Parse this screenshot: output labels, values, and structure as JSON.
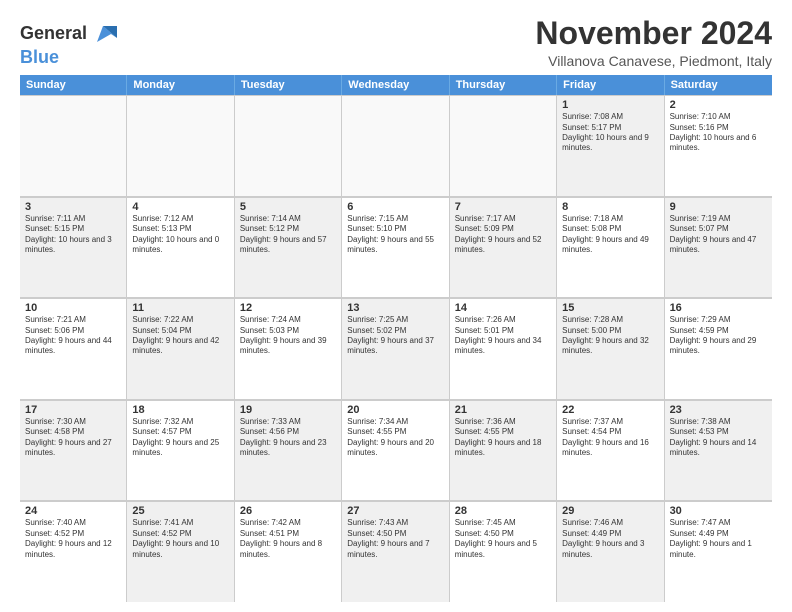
{
  "logo": {
    "line1": "General",
    "line2": "Blue"
  },
  "title": "November 2024",
  "subtitle": "Villanova Canavese, Piedmont, Italy",
  "days": [
    "Sunday",
    "Monday",
    "Tuesday",
    "Wednesday",
    "Thursday",
    "Friday",
    "Saturday"
  ],
  "rows": [
    [
      {
        "day": "",
        "text": "",
        "empty": true
      },
      {
        "day": "",
        "text": "",
        "empty": true
      },
      {
        "day": "",
        "text": "",
        "empty": true
      },
      {
        "day": "",
        "text": "",
        "empty": true
      },
      {
        "day": "",
        "text": "",
        "empty": true
      },
      {
        "day": "1",
        "text": "Sunrise: 7:08 AM\nSunset: 5:17 PM\nDaylight: 10 hours and 9 minutes.",
        "shaded": true
      },
      {
        "day": "2",
        "text": "Sunrise: 7:10 AM\nSunset: 5:16 PM\nDaylight: 10 hours and 6 minutes.",
        "shaded": false
      }
    ],
    [
      {
        "day": "3",
        "text": "Sunrise: 7:11 AM\nSunset: 5:15 PM\nDaylight: 10 hours and 3 minutes.",
        "shaded": true
      },
      {
        "day": "4",
        "text": "Sunrise: 7:12 AM\nSunset: 5:13 PM\nDaylight: 10 hours and 0 minutes.",
        "shaded": false
      },
      {
        "day": "5",
        "text": "Sunrise: 7:14 AM\nSunset: 5:12 PM\nDaylight: 9 hours and 57 minutes.",
        "shaded": true
      },
      {
        "day": "6",
        "text": "Sunrise: 7:15 AM\nSunset: 5:10 PM\nDaylight: 9 hours and 55 minutes.",
        "shaded": false
      },
      {
        "day": "7",
        "text": "Sunrise: 7:17 AM\nSunset: 5:09 PM\nDaylight: 9 hours and 52 minutes.",
        "shaded": true
      },
      {
        "day": "8",
        "text": "Sunrise: 7:18 AM\nSunset: 5:08 PM\nDaylight: 9 hours and 49 minutes.",
        "shaded": false
      },
      {
        "day": "9",
        "text": "Sunrise: 7:19 AM\nSunset: 5:07 PM\nDaylight: 9 hours and 47 minutes.",
        "shaded": true
      }
    ],
    [
      {
        "day": "10",
        "text": "Sunrise: 7:21 AM\nSunset: 5:06 PM\nDaylight: 9 hours and 44 minutes.",
        "shaded": false
      },
      {
        "day": "11",
        "text": "Sunrise: 7:22 AM\nSunset: 5:04 PM\nDaylight: 9 hours and 42 minutes.",
        "shaded": true
      },
      {
        "day": "12",
        "text": "Sunrise: 7:24 AM\nSunset: 5:03 PM\nDaylight: 9 hours and 39 minutes.",
        "shaded": false
      },
      {
        "day": "13",
        "text": "Sunrise: 7:25 AM\nSunset: 5:02 PM\nDaylight: 9 hours and 37 minutes.",
        "shaded": true
      },
      {
        "day": "14",
        "text": "Sunrise: 7:26 AM\nSunset: 5:01 PM\nDaylight: 9 hours and 34 minutes.",
        "shaded": false
      },
      {
        "day": "15",
        "text": "Sunrise: 7:28 AM\nSunset: 5:00 PM\nDaylight: 9 hours and 32 minutes.",
        "shaded": true
      },
      {
        "day": "16",
        "text": "Sunrise: 7:29 AM\nSunset: 4:59 PM\nDaylight: 9 hours and 29 minutes.",
        "shaded": false
      }
    ],
    [
      {
        "day": "17",
        "text": "Sunrise: 7:30 AM\nSunset: 4:58 PM\nDaylight: 9 hours and 27 minutes.",
        "shaded": true
      },
      {
        "day": "18",
        "text": "Sunrise: 7:32 AM\nSunset: 4:57 PM\nDaylight: 9 hours and 25 minutes.",
        "shaded": false
      },
      {
        "day": "19",
        "text": "Sunrise: 7:33 AM\nSunset: 4:56 PM\nDaylight: 9 hours and 23 minutes.",
        "shaded": true
      },
      {
        "day": "20",
        "text": "Sunrise: 7:34 AM\nSunset: 4:55 PM\nDaylight: 9 hours and 20 minutes.",
        "shaded": false
      },
      {
        "day": "21",
        "text": "Sunrise: 7:36 AM\nSunset: 4:55 PM\nDaylight: 9 hours and 18 minutes.",
        "shaded": true
      },
      {
        "day": "22",
        "text": "Sunrise: 7:37 AM\nSunset: 4:54 PM\nDaylight: 9 hours and 16 minutes.",
        "shaded": false
      },
      {
        "day": "23",
        "text": "Sunrise: 7:38 AM\nSunset: 4:53 PM\nDaylight: 9 hours and 14 minutes.",
        "shaded": true
      }
    ],
    [
      {
        "day": "24",
        "text": "Sunrise: 7:40 AM\nSunset: 4:52 PM\nDaylight: 9 hours and 12 minutes.",
        "shaded": false
      },
      {
        "day": "25",
        "text": "Sunrise: 7:41 AM\nSunset: 4:52 PM\nDaylight: 9 hours and 10 minutes.",
        "shaded": true
      },
      {
        "day": "26",
        "text": "Sunrise: 7:42 AM\nSunset: 4:51 PM\nDaylight: 9 hours and 8 minutes.",
        "shaded": false
      },
      {
        "day": "27",
        "text": "Sunrise: 7:43 AM\nSunset: 4:50 PM\nDaylight: 9 hours and 7 minutes.",
        "shaded": true
      },
      {
        "day": "28",
        "text": "Sunrise: 7:45 AM\nSunset: 4:50 PM\nDaylight: 9 hours and 5 minutes.",
        "shaded": false
      },
      {
        "day": "29",
        "text": "Sunrise: 7:46 AM\nSunset: 4:49 PM\nDaylight: 9 hours and 3 minutes.",
        "shaded": true
      },
      {
        "day": "30",
        "text": "Sunrise: 7:47 AM\nSunset: 4:49 PM\nDaylight: 9 hours and 1 minute.",
        "shaded": false
      }
    ]
  ]
}
